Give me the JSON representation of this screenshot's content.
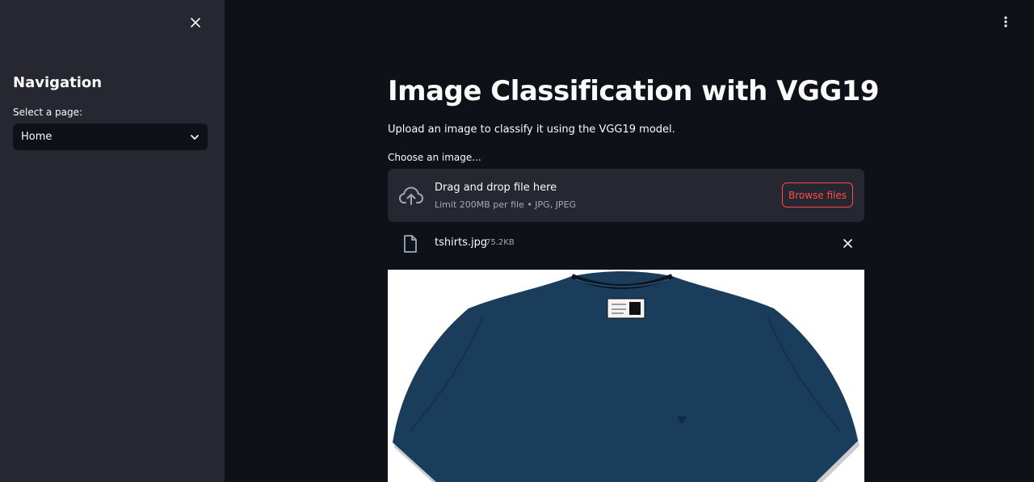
{
  "sidebar": {
    "title": "Navigation",
    "select_label": "Select a page:",
    "select_value": "Home"
  },
  "main": {
    "title": "Image Classification with VGG19",
    "description": "Upload an image to classify it using the VGG19 model.",
    "uploader": {
      "label": "Choose an image...",
      "drop_text": "Drag and drop file here",
      "limit_text": "Limit 200MB per file • JPG, JPEG",
      "browse_label": "Browse files"
    },
    "file": {
      "name": "tshirts.jpg",
      "size": "75.2KB"
    }
  },
  "colors": {
    "background": "#0e1117",
    "sidebar": "#262730",
    "accent": "#ff4b4b",
    "muted_text": "#a3a8b8",
    "shirt": "#1b3d5c"
  },
  "icons": {
    "sidebar_close": "close-icon",
    "select_chevron": "chevron-down-icon",
    "menu": "vertical-dots-icon",
    "upload": "cloud-upload-icon",
    "file": "file-icon",
    "remove": "close-icon"
  }
}
